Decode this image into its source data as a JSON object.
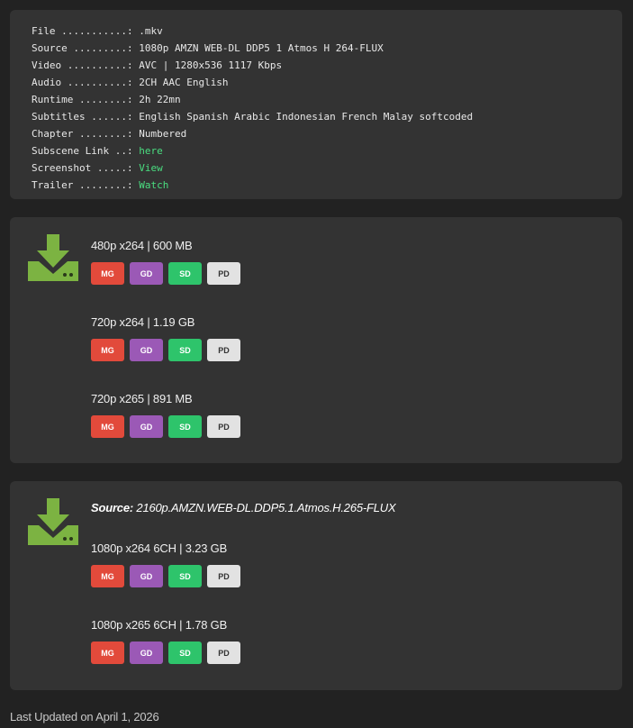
{
  "info": [
    {
      "label": "File ...........: ",
      "value": ".mkv"
    },
    {
      "label": "Source .........: ",
      "value": "1080p AMZN WEB-DL DDP5 1 Atmos H 264-FLUX"
    },
    {
      "label": "Video ..........: ",
      "value": "AVC | 1280x536 1117 Kbps"
    },
    {
      "label": "Audio ..........: ",
      "value": "2CH AAC English"
    },
    {
      "label": "Runtime ........: ",
      "value": "2h 22mn"
    },
    {
      "label": "Subtitles ......: ",
      "value": "English Spanish Arabic Indonesian French Malay softcoded"
    },
    {
      "label": "Chapter ........: ",
      "value": "Numbered"
    },
    {
      "label": "Subscene Link ..: ",
      "link": "here"
    },
    {
      "label": "Screenshot .....: ",
      "link": "View"
    },
    {
      "label": "Trailer ........: ",
      "link": "Watch"
    }
  ],
  "buttons": {
    "mg": "MG",
    "gd": "GD",
    "sd": "SD",
    "pd": "PD"
  },
  "section1": {
    "qualities": [
      {
        "title": "480p x264 | 600 MB"
      },
      {
        "title": "720p x264 | 1.19 GB"
      },
      {
        "title": "720p x265 | 891 MB"
      }
    ]
  },
  "section2": {
    "source_label": "Source:",
    "source_value": " 2160p.AMZN.WEB-DL.DDP5.1.Atmos.H.265-FLUX",
    "qualities": [
      {
        "title": "1080p x264 6CH | 3.23 GB"
      },
      {
        "title": "1080p x265 6CH | 1.78 GB"
      }
    ]
  },
  "footer": {
    "text": "Last Updated on April 1, 2026"
  },
  "colors": {
    "icon_green": "#7cb342",
    "link_green": "#4ade80",
    "mg": "#e24a3b",
    "gd": "#9b59b6",
    "sd": "#2ec46b",
    "pd": "#e2e2e2"
  }
}
